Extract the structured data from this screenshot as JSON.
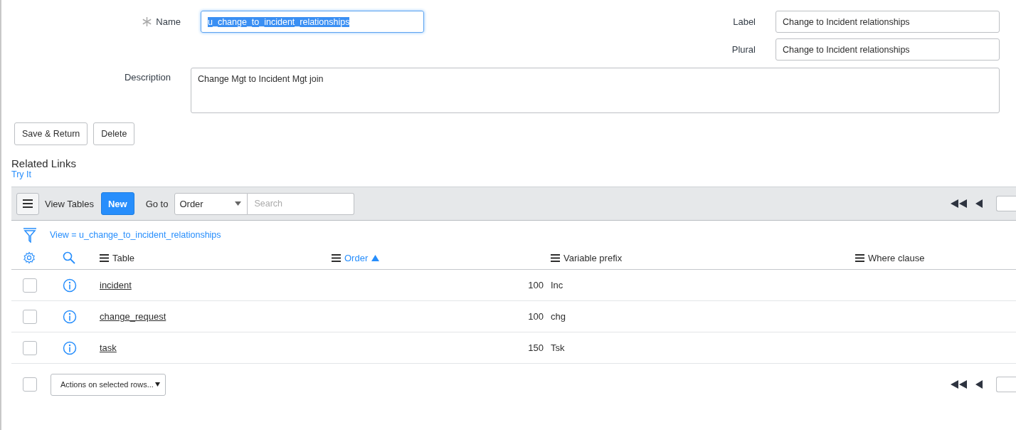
{
  "form": {
    "name": {
      "label": "Name",
      "value": "u_change_to_incident_relationships",
      "required": true,
      "focused": true,
      "text_selected": true
    },
    "label": {
      "label": "Label",
      "value": "Change to Incident relationships"
    },
    "plural": {
      "label": "Plural",
      "value": "Change to Incident relationships"
    },
    "description": {
      "label": "Description",
      "value": "Change Mgt to Incident Mgt join"
    },
    "buttons": [
      "Save & Return",
      "Delete"
    ]
  },
  "related_links": {
    "title": "Related Links",
    "links": [
      "Try It"
    ]
  },
  "list_toolbar": {
    "title": "View Tables",
    "new_button": "New",
    "goto_label": "Go to",
    "goto_field": "Order",
    "search": {
      "placeholder": "Search"
    }
  },
  "filter": {
    "text": "View = u_change_to_incident_relationships"
  },
  "table": {
    "columns": [
      {
        "label": "Table",
        "sorted": false
      },
      {
        "label": "Order",
        "sorted": true
      },
      {
        "label": "Variable prefix",
        "sorted": false
      },
      {
        "label": "Where clause",
        "sorted": false
      }
    ],
    "rows": [
      {
        "checked": false,
        "table": "incident",
        "order": "100",
        "prefix": "Inc"
      },
      {
        "checked": false,
        "table": "change_request",
        "order": "100",
        "prefix": "chg"
      },
      {
        "checked": false,
        "table": "task",
        "order": "150",
        "prefix": "Tsk"
      }
    ]
  },
  "footer": {
    "checked": false,
    "actions_placeholder": "Actions on selected rows..."
  }
}
